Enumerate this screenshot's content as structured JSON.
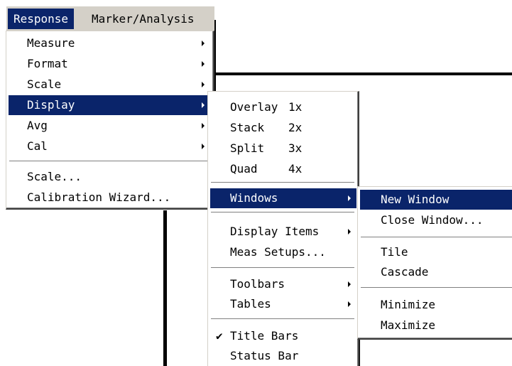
{
  "menubar": {
    "items": [
      {
        "label": "Response"
      },
      {
        "label": "Marker/Analysis"
      }
    ]
  },
  "response_menu": {
    "items": [
      {
        "label": "Measure"
      },
      {
        "label": "Format"
      },
      {
        "label": "Scale"
      },
      {
        "label": "Display"
      },
      {
        "label": "Avg"
      },
      {
        "label": "Cal"
      },
      {
        "label": "Scale..."
      },
      {
        "label": "Calibration Wizard..."
      }
    ]
  },
  "display_menu": {
    "items": [
      {
        "label": "Overlay",
        "accel": "1x"
      },
      {
        "label": "Stack",
        "accel": "2x"
      },
      {
        "label": "Split",
        "accel": "3x"
      },
      {
        "label": "Quad",
        "accel": "4x"
      },
      {
        "label": "Windows"
      },
      {
        "label": "Display Items"
      },
      {
        "label": "Meas Setups..."
      },
      {
        "label": "Toolbars"
      },
      {
        "label": "Tables"
      },
      {
        "label": "Title Bars",
        "check": "✔"
      },
      {
        "label": "Status Bar"
      }
    ]
  },
  "windows_menu": {
    "items": [
      {
        "label": "New Window"
      },
      {
        "label": "Close Window..."
      },
      {
        "label": "Tile"
      },
      {
        "label": "Cascade"
      },
      {
        "label": "Minimize"
      },
      {
        "label": "Maximize"
      }
    ]
  },
  "colors": {
    "highlight": "#0a246a",
    "menubar_bg": "#d4d0c8",
    "menu_bg": "#ffffff"
  }
}
